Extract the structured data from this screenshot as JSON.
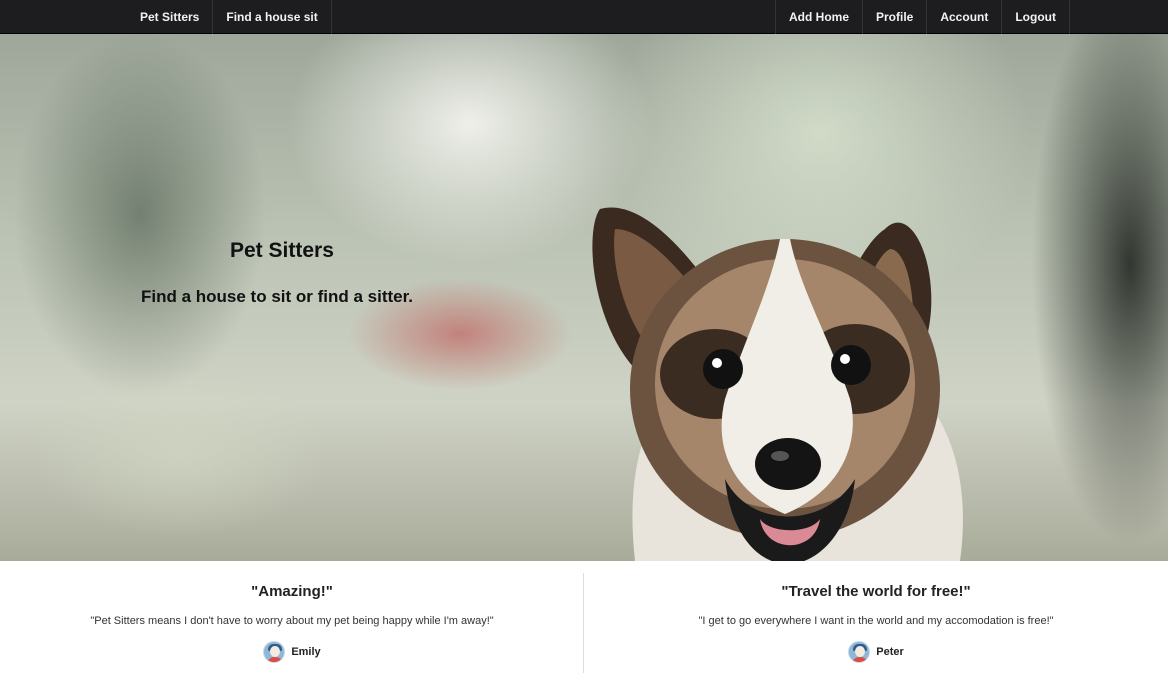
{
  "navbar": {
    "brand": "Pet Sitters",
    "left_items": [
      "Find a house sit"
    ],
    "right_items": [
      "Add Home",
      "Profile",
      "Account",
      "Logout"
    ]
  },
  "hero": {
    "title": "Pet Sitters",
    "subtitle": "Find a house to sit or find a sitter."
  },
  "testimonials": [
    {
      "heading": "\"Amazing!\"",
      "quote": "\"Pet Sitters means I don't have to worry about my pet being happy while I'm away!\"",
      "author": "Emily",
      "avatar_icon": "user-avatar-icon"
    },
    {
      "heading": "\"Travel the world for free!\"",
      "quote": "\"I get to go everywhere I want in the world and my accomodation is free!\"",
      "author": "Peter",
      "avatar_icon": "user-avatar-icon"
    }
  ],
  "colors": {
    "navbar_bg": "#1d1d1f",
    "nav_text": "#f2f2f2"
  }
}
